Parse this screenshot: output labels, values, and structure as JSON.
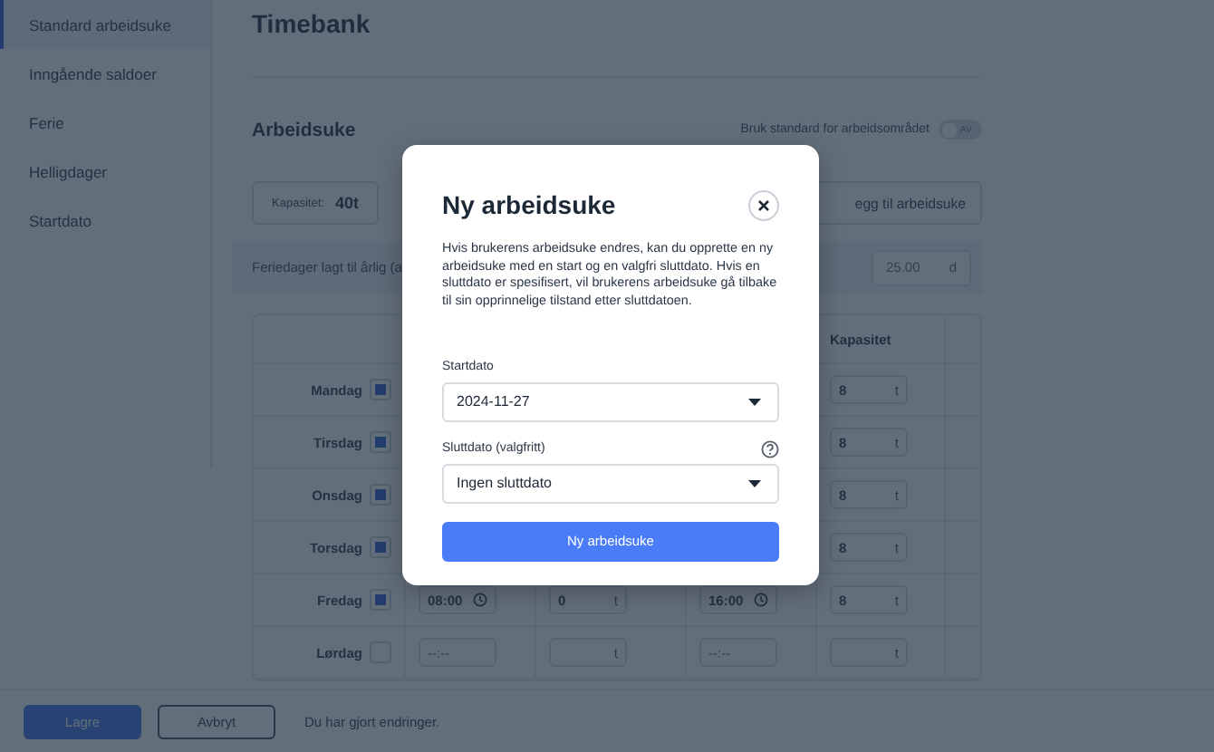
{
  "sidebar": {
    "items": [
      {
        "label": "Standard arbeidsuke",
        "selected": true
      },
      {
        "label": "Inngående saldoer",
        "selected": false
      },
      {
        "label": "Ferie",
        "selected": false
      },
      {
        "label": "Helligdager",
        "selected": false
      },
      {
        "label": "Startdato",
        "selected": false
      }
    ]
  },
  "page_title": "Timebank",
  "section_title": "Arbeidsuke",
  "workspace_toggle": {
    "label": "Bruk standard for arbeidsområdet",
    "on": false,
    "state_text": "AV"
  },
  "capacity": {
    "label": "Kapasitet:",
    "value": "40t"
  },
  "add_week_button": "egg til arbeidsuke",
  "vacation": {
    "label": "Feriedager lagt til årlig (a",
    "value": "25.00",
    "unit": "d"
  },
  "table": {
    "capacity_header": "Kapasitet",
    "rows": [
      {
        "day": "Mandag",
        "checked": true,
        "capacity": "8",
        "unit": "t"
      },
      {
        "day": "Tirsdag",
        "checked": true,
        "capacity": "8",
        "unit": "t"
      },
      {
        "day": "Onsdag",
        "checked": true,
        "capacity": "8",
        "unit": "t"
      },
      {
        "day": "Torsdag",
        "checked": true,
        "capacity": "8",
        "unit": "t"
      },
      {
        "day": "Fredag",
        "checked": true,
        "start": "08:00",
        "break": "0",
        "break_unit": "t",
        "end": "16:00",
        "capacity": "8",
        "unit": "t"
      },
      {
        "day": "Lørdag",
        "checked": false,
        "start_placeholder": "--:--",
        "break_unit": "t",
        "end_placeholder": "--:--",
        "capacity": "",
        "unit": "t"
      }
    ]
  },
  "footer": {
    "save_button": "Lagre",
    "cancel_button": "Avbryt",
    "status": "Du har gjort endringer."
  },
  "dialog": {
    "title": "Ny arbeidsuke",
    "text": "Hvis brukerens arbeidsuke endres, kan du opprette en ny arbeidsuke med en start og en valgfri sluttdato. Hvis en sluttdato er spesifisert, vil brukerens arbeidsuke gå tilbake til sin opprinnelige tilstand etter sluttdatoen.",
    "fields": [
      {
        "label": "Startdato",
        "value": "2024-11-27",
        "help": false
      },
      {
        "label": "Sluttdato (valgfritt)",
        "value": "Ingen sluttdato",
        "help": true
      }
    ],
    "submit_button": "Ny arbeidsuke"
  }
}
